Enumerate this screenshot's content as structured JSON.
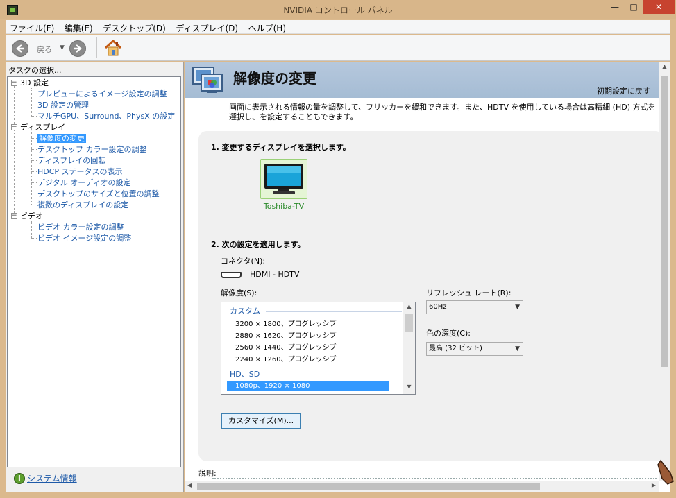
{
  "window": {
    "title": "NVIDIA コントロール パネル",
    "minimize": "—",
    "maximize": "□",
    "close": "✕"
  },
  "menu": [
    "ファイル(F)",
    "編集(E)",
    "デスクトップ(D)",
    "ディスプレイ(D)",
    "ヘルプ(H)"
  ],
  "toolbar": {
    "back_label": "戻る",
    "back_icon": "back-arrow-icon",
    "forward_icon": "forward-arrow-icon",
    "home_icon": "home-icon"
  },
  "left_panel": {
    "header": "タスクの選択...",
    "tree": [
      {
        "label": "3D 設定",
        "type": "group",
        "children": [
          {
            "label": "プレビューによるイメージ設定の調整"
          },
          {
            "label": "3D 設定の管理"
          },
          {
            "label": "マルチGPU、Surround、PhysX の設定"
          }
        ]
      },
      {
        "label": "ディスプレイ",
        "type": "group",
        "children": [
          {
            "label": "解像度の変更",
            "selected": true
          },
          {
            "label": "デスクトップ カラー設定の調整"
          },
          {
            "label": "ディスプレイの回転"
          },
          {
            "label": "HDCP ステータスの表示"
          },
          {
            "label": "デジタル オーディオの設定"
          },
          {
            "label": "デスクトップのサイズと位置の調整"
          },
          {
            "label": "複数のディスプレイの設定"
          }
        ]
      },
      {
        "label": "ビデオ",
        "type": "group",
        "children": [
          {
            "label": "ビデオ カラー設定の調整"
          },
          {
            "label": "ビデオ イメージ設定の調整"
          }
        ]
      }
    ],
    "system_info": "システム情報"
  },
  "main": {
    "title": "解像度の変更",
    "restore_defaults": "初期設定に戻す",
    "description": "画面に表示される情報の量を調整して、フリッカーを緩和できます。また、HDTV を使用している場合は高精細 (HD) 方式を選択し、を設定することもできます。",
    "section1": "1. 変更するディスプレイを選択します。",
    "display_name": "Toshiba-TV",
    "section2": "2. 次の設定を適用します。",
    "connector_label": "コネクタ(N):",
    "connector_value": "HDMI - HDTV",
    "resolution_label": "解像度(S):",
    "resolution_groups": [
      {
        "name": "カスタム",
        "items": [
          "3200 × 1800、プログレッシブ",
          "2880 × 1620、プログレッシブ",
          "2560 × 1440、プログレッシブ",
          "2240 × 1260、プログレッシブ"
        ]
      },
      {
        "name": "HD、SD",
        "items": [
          "1080p、1920 × 1080"
        ]
      }
    ],
    "selected_resolution": "1080p、1920 × 1080",
    "refresh_label": "リフレッシュ レート(R):",
    "refresh_value": "60Hz",
    "color_depth_label": "色の深度(C):",
    "color_depth_value": "最高 (32 ビット)",
    "customize_button": "カスタマイズ(M)...",
    "desc_label": "説明:"
  },
  "colors": {
    "titlebar": "#d8b68a",
    "banner": "#a5bcd4",
    "link": "#1e5aa8",
    "selection": "#3399ff",
    "nvidia_green": "#76b900",
    "close_red": "#c7432f"
  }
}
